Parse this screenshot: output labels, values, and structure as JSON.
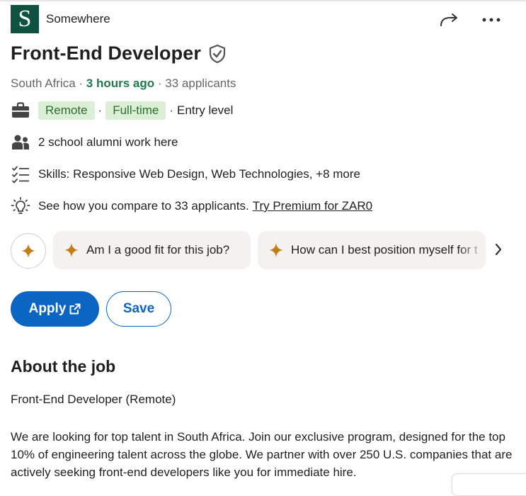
{
  "company": {
    "logo_letter": "S",
    "name": "Somewhere"
  },
  "job": {
    "title": "Front-End Developer",
    "location": "South Africa",
    "posted": "3 hours ago",
    "applicants": "33 applicants",
    "workplace": "Remote",
    "type": "Full-time",
    "level": "Entry level",
    "alumni": "2 school alumni work here",
    "skills": "Skills: Responsive Web Design, Web Technologies, +8 more",
    "compare_text": "See how you compare to 33 applicants.",
    "premium_link": "Try Premium for ZAR0"
  },
  "ai_prompts": [
    "Am I a good fit for this job?",
    "How can I best position myself for t"
  ],
  "actions": {
    "apply": "Apply",
    "save": "Save"
  },
  "about": {
    "heading": "About the job",
    "subtitle": "Front-End Developer (Remote)",
    "description": "We are looking for top talent in South Africa. Join our exclusive program, designed for the top 10% of engineering talent across the globe. We partner with over 250 U.S. companies that are actively seeking front-end developers like you for immediate hire."
  },
  "colors": {
    "brand_blue": "#0a66c2",
    "logo_green": "#0f5240",
    "time_green": "#1f7a4d",
    "pill_bg": "#dbeed6",
    "spark": "#c37d16"
  },
  "icons": [
    "share-icon",
    "more-icon",
    "verified-shield-icon",
    "briefcase-icon",
    "people-icon",
    "checklist-icon",
    "lightbulb-icon",
    "sparkle-icon",
    "chevron-right-icon",
    "external-link-icon"
  ]
}
